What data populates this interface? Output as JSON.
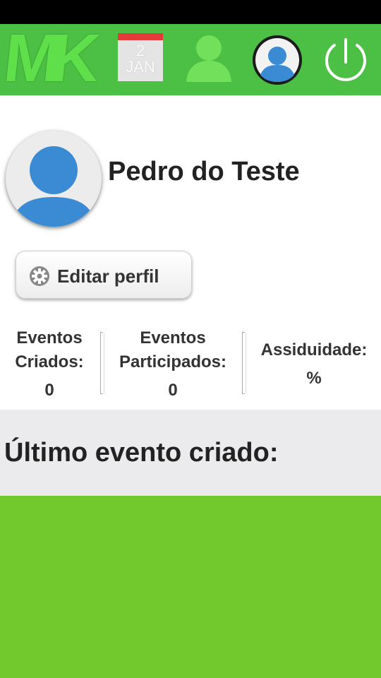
{
  "header": {
    "logo_text": "MK",
    "calendar": {
      "day": "2",
      "month": "JAN"
    },
    "icons": [
      "calendar-icon",
      "person-icon",
      "profile-avatar-icon",
      "power-icon"
    ],
    "bg_color": "#4cc044"
  },
  "profile": {
    "name": "Pedro do Teste",
    "edit_label": "Editar perfil"
  },
  "stats": {
    "created_label_1": "Eventos",
    "created_label_2": "Criados:",
    "created_value": "0",
    "participated_label_1": "Eventos",
    "participated_label_2": "Participados:",
    "participated_value": "0",
    "attendance_label": "Assiduidade:",
    "attendance_value": "%"
  },
  "last_event": {
    "title": "Último evento criado:"
  },
  "colors": {
    "accent_green": "#72c92e",
    "avatar_blue": "#3a8bd4",
    "section_gray": "#ebebed"
  }
}
